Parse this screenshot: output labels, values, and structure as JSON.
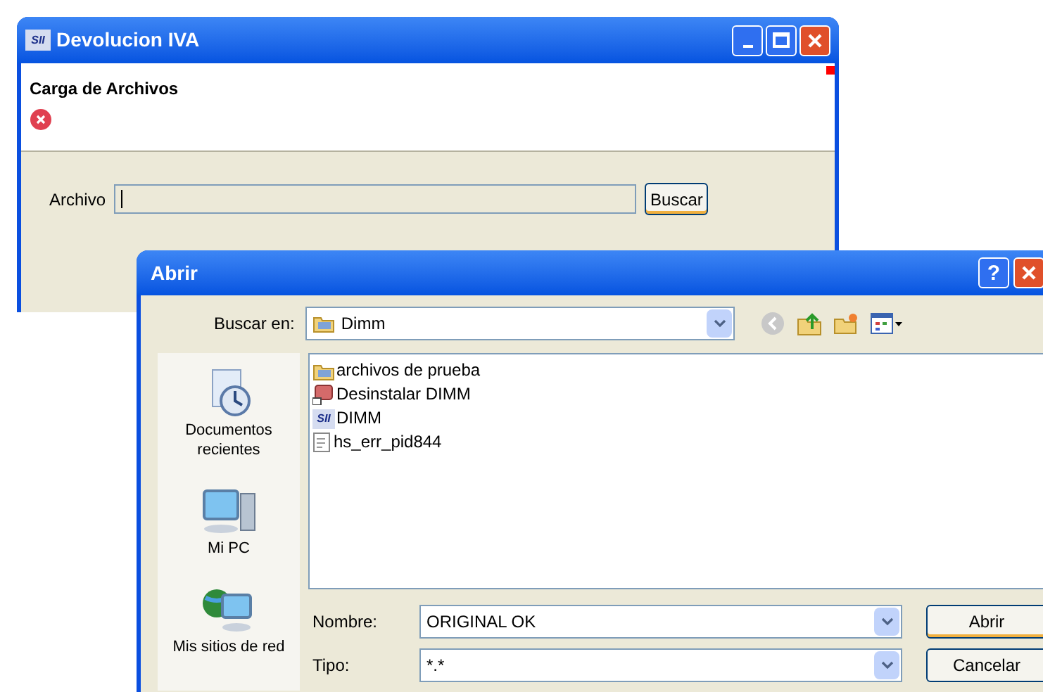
{
  "main_window": {
    "title": "Devolucion IVA",
    "logo": "SII",
    "header_title": "Carga de Archivos",
    "file_label": "Archivo",
    "search_button": "Buscar"
  },
  "dialog": {
    "title": "Abrir",
    "help_button": "?",
    "look_in_label": "Buscar en:",
    "look_in_value": "Dimm",
    "places": [
      {
        "kind": "recent",
        "label": "Documentos recientes"
      },
      {
        "kind": "computer",
        "label": "Mi PC"
      },
      {
        "kind": "network",
        "label": "Mis sitios de red"
      }
    ],
    "files": [
      {
        "kind": "folder",
        "name": "archivos de prueba"
      },
      {
        "kind": "installer",
        "name": "Desinstalar DIMM"
      },
      {
        "kind": "app",
        "name": "DIMM",
        "logo": "SII"
      },
      {
        "kind": "text",
        "name": "hs_err_pid844"
      }
    ],
    "name_label": "Nombre:",
    "name_value": "ORIGINAL OK",
    "type_label": "Tipo:",
    "type_value": "*.*",
    "open_button": "Abrir",
    "cancel_button": "Cancelar"
  }
}
